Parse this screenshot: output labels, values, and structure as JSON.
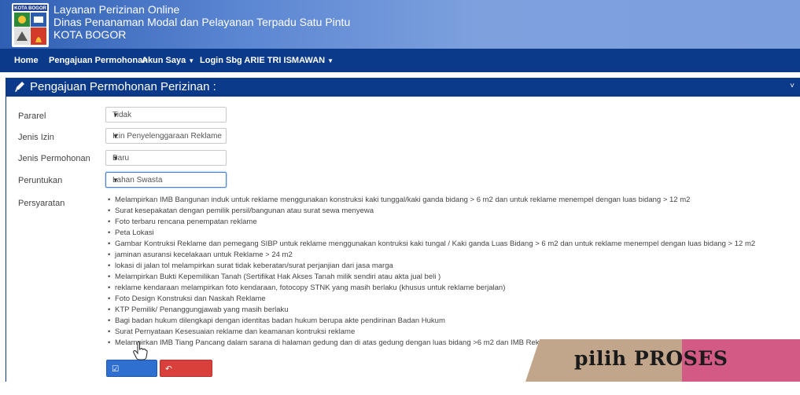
{
  "header": {
    "logo_text": "KOTA BOGOR",
    "title_line1": "Layanan Perizinan Online",
    "title_line2": "Dinas Penanaman Modal dan Pelayanan Terpadu Satu Pintu",
    "title_line3": "KOTA BOGOR"
  },
  "nav": {
    "home": "Home",
    "pengajuan": "Pengajuan Permohonan",
    "akun": "Akun Saya",
    "login_prefix": "Login Sbg",
    "login_user": "ARIE TRI ISMAWAN"
  },
  "panel": {
    "title": "Pengajuan Permohonan Perizinan :"
  },
  "form": {
    "pararel": {
      "label": "Pararel",
      "value": "Tidak"
    },
    "jenis_izin": {
      "label": "Jenis Izin",
      "value": "Izin Penyelenggaraan Reklame"
    },
    "jenis_permohonan": {
      "label": "Jenis Permohonan",
      "value": "Baru"
    },
    "peruntukan": {
      "label": "Peruntukan",
      "value": "Lahan Swasta"
    },
    "persyaratan_label": "Persyaratan"
  },
  "requirements": [
    "Melampirkan IMB Bangunan induk untuk reklame menggunakan konstruksi kaki tunggal/kaki ganda bidang > 6 m2 dan untuk reklame menempel dengan luas bidang > 12 m2",
    "Surat kesepakatan dengan pemilik persil/bangunan atau surat sewa menyewa",
    "Foto terbaru rencana penempatan reklame",
    "Peta Lokasi",
    "Gambar Kontruksi Reklame dan pemegang SIBP untuk reklame menggunakan kontruksi kaki tungal / Kaki ganda Luas Bidang > 6 m2 dan untuk reklame menempel dengan luas bidang > 12 m2",
    "jaminan asuransi kecelakaan untuk Reklame > 24 m2",
    "lokasi di jalan tol melampirkan surat tidak keberatan/surat perjanjian dari jasa marga",
    "Melampirkan Bukti Kepemilikan Tanah (Sertifikat Hak Akses Tanah milik sendiri atau akta jual beli )",
    "reklame kendaraan melampirkan foto kendaraan, fotocopy STNK yang masih berlaku (khusus untuk reklame berjalan)",
    "Foto Design Konstruksi dan Naskah Reklame",
    "KTP Pemilik/ Penanggungjawab yang masih berlaku",
    "Bagi badan hukum dilengkapi dengan identitas badan hukum berupa akte pendirinan Badan Hukum",
    "Surat Pernyataan Kesesuaian reklame dan keamanan kontruksi reklame",
    "Melampirkan IMB Tiang Pancang dalam sarana di halaman gedung dan di atas gedung dengan luas bidang >6 m2 dan IMB Reklame ... untuk luas bidang > 12 m2"
  ],
  "buttons": {
    "proses": "PROSES",
    "kembali": "KEMBALI"
  },
  "overlay": {
    "caption": "pilih PROSES"
  },
  "colors": {
    "navbar": "#0c3a8a",
    "header_gradient_start": "#2f5fb3",
    "proses_button": "#2f6fd0",
    "kembali_button": "#d9403c",
    "banner_tan": "#c2a68c",
    "banner_pink": "#d35a85"
  }
}
